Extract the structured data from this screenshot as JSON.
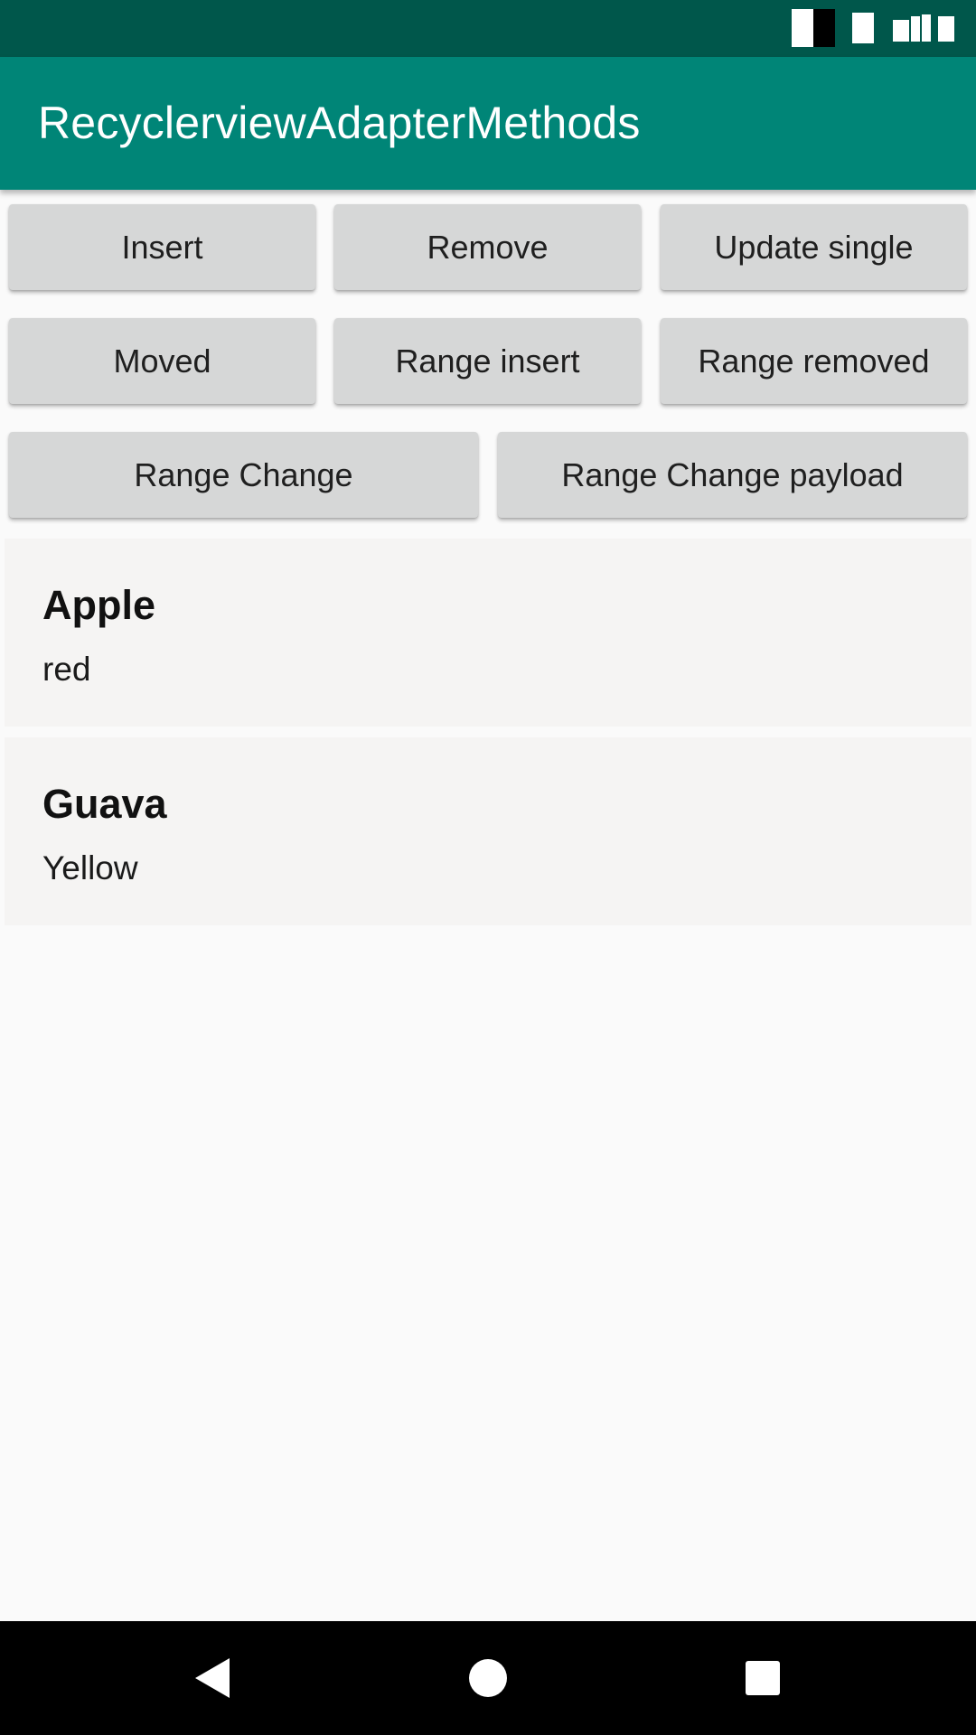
{
  "status_bar": {
    "icons": [
      "sim-icon",
      "battery-icon",
      "signal-icon"
    ]
  },
  "app_bar": {
    "title": "RecyclerviewAdapterMethods"
  },
  "buttons": {
    "insert": "Insert",
    "remove": "Remove",
    "update_single": "Update single",
    "moved": "Moved",
    "range_insert": "Range insert",
    "range_removed": "Range removed",
    "range_change": "Range Change",
    "range_change_payload": "Range Change payload"
  },
  "list": {
    "items": [
      {
        "title": "Apple",
        "subtitle": "red"
      },
      {
        "title": "Guava",
        "subtitle": "Yellow"
      }
    ]
  },
  "nav_bar": {
    "icons": [
      "back-icon",
      "home-icon",
      "recents-icon"
    ]
  },
  "colors": {
    "status_bar": "#00574b",
    "app_bar": "#008577",
    "button": "#d6d7d7",
    "list_item": "#f5f4f3",
    "background": "#fafafa"
  }
}
